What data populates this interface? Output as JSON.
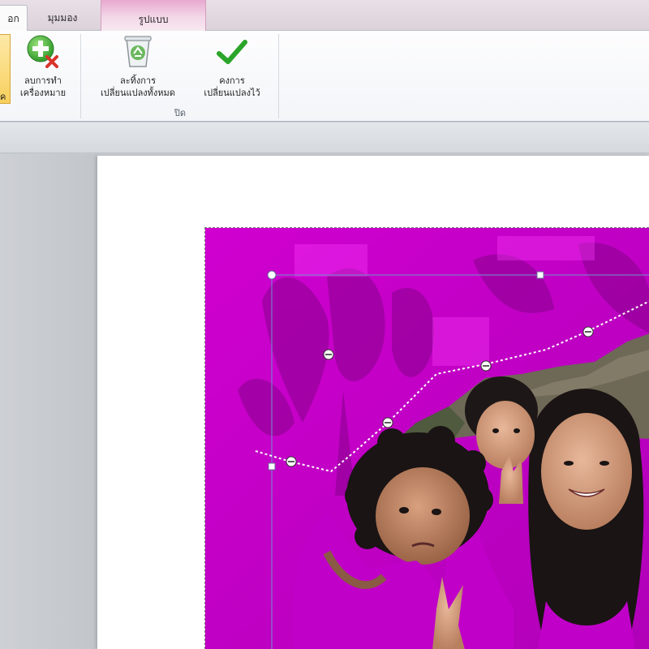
{
  "tabs": {
    "active_label": "อก",
    "view_label": "มุมมอง",
    "contextual_label": "รูปแบบ"
  },
  "ribbon": {
    "partial_button_label": "ค",
    "delete_mark": {
      "line1": "ลบการทำ",
      "line2": "เครื่องหมาย"
    },
    "discard_all": {
      "line1": "ละทิ้งการ",
      "line2": "เปลี่ยนแปลงทั้งหมด"
    },
    "keep_changes": {
      "line1": "คงการ",
      "line2": "เปลี่ยนแปลงไว้"
    },
    "close_group_label": "ปิด"
  },
  "colors": {
    "removal_overlay": "#c400c4",
    "keep_check": "#2aa52a",
    "selection_border": "#7d7dc8"
  },
  "icons": {
    "delete_mark": "plus-with-x-icon",
    "discard_all": "recycle-bin-icon",
    "keep_changes": "checkmark-icon"
  }
}
